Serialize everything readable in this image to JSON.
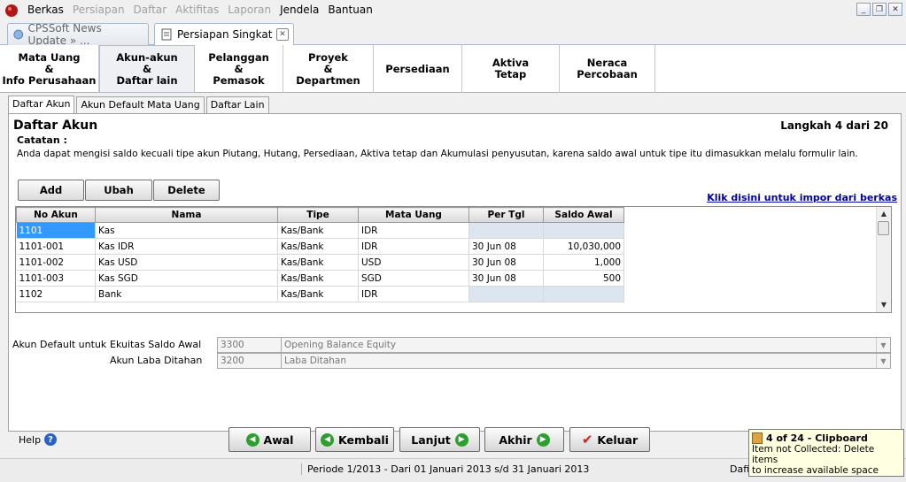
{
  "menu": {
    "items": [
      {
        "label": "Berkas",
        "enabled": true
      },
      {
        "label": "Persiapan",
        "enabled": false
      },
      {
        "label": "Daftar",
        "enabled": false
      },
      {
        "label": "Aktifitas",
        "enabled": false
      },
      {
        "label": "Laporan",
        "enabled": false
      },
      {
        "label": "Jendela",
        "enabled": true
      },
      {
        "label": "Bantuan",
        "enabled": true
      }
    ],
    "window_controls": [
      "minimize-icon",
      "restore-icon",
      "close-icon"
    ]
  },
  "doc_tabs": [
    {
      "label": "CPSSoft News Update » ...",
      "active": false
    },
    {
      "label": "Persiapan Singkat",
      "active": true
    }
  ],
  "steps": [
    {
      "label": "Mata Uang\n&\nInfo Perusahaan",
      "active": false
    },
    {
      "label": "Akun-akun\n&\nDaftar lain",
      "active": true
    },
    {
      "label": "Pelanggan\n&\nPemasok",
      "active": false
    },
    {
      "label": "Proyek\n&\nDepartmen",
      "active": false
    },
    {
      "label": "Persediaan",
      "active": false
    },
    {
      "label": "Aktiva\nTetap",
      "active": false
    },
    {
      "label": "Neraca\nPercobaan",
      "active": false
    }
  ],
  "subtabs": [
    {
      "label": "Daftar Akun",
      "active": true
    },
    {
      "label": "Akun Default Mata Uang",
      "active": false
    },
    {
      "label": "Daftar Lain",
      "active": false
    }
  ],
  "panel": {
    "title": "Daftar Akun",
    "step_counter": "Langkah 4 dari 20",
    "note_label": "Catatan :",
    "note_text": "Anda dapat mengisi saldo kecuali tipe akun Piutang, Hutang, Persediaan, Aktiva tetap dan Akumulasi penyusutan, karena saldo awal untuk tipe itu dimasukkan melalu formulir lain.",
    "buttons": {
      "add": "Add",
      "edit": "Ubah",
      "delete": "Delete"
    },
    "import_link": "Klik disini untuk impor dari berkas"
  },
  "grid": {
    "columns": [
      "No Akun",
      "Nama",
      "Tipe",
      "Mata Uang",
      "Per Tgl",
      "Saldo Awal"
    ],
    "rows": [
      {
        "no": "1101",
        "nama": "Kas",
        "tipe": "Kas/Bank",
        "mata_uang": "IDR",
        "per_tgl": "",
        "saldo": ""
      },
      {
        "no": "1101-001",
        "nama": "Kas IDR",
        "tipe": "Kas/Bank",
        "mata_uang": "IDR",
        "per_tgl": "30 Jun 08",
        "saldo": "10,030,000"
      },
      {
        "no": "1101-002",
        "nama": "Kas USD",
        "tipe": "Kas/Bank",
        "mata_uang": "USD",
        "per_tgl": "30 Jun 08",
        "saldo": "1,000"
      },
      {
        "no": "1101-003",
        "nama": "Kas SGD",
        "tipe": "Kas/Bank",
        "mata_uang": "SGD",
        "per_tgl": "30 Jun 08",
        "saldo": "500"
      },
      {
        "no": "1102",
        "nama": "Bank",
        "tipe": "Kas/Bank",
        "mata_uang": "IDR",
        "per_tgl": "",
        "saldo": ""
      }
    ]
  },
  "defaults": {
    "section_label": "Akun Default untuk",
    "equity_label": "Ekuitas Saldo Awal",
    "equity_code": "3300",
    "equity_name": "Opening Balance Equity",
    "retained_label": "Akun Laba Ditahan",
    "retained_code": "3200",
    "retained_name": "Laba Ditahan"
  },
  "footer": {
    "help": "Help",
    "first": "Awal",
    "back": "Kembali",
    "next": "Lanjut",
    "last": "Akhir",
    "exit": "Keluar"
  },
  "status": {
    "period": "Periode 1/2013 - Dari 01 Januari 2013 s/d 31 Januari 2013",
    "right_partial": "Dafi"
  },
  "clipboard_tooltip": {
    "title": "4 of 24 - Clipboard",
    "line1": "Item not Collected: Delete items",
    "line2": "to increase available space"
  }
}
